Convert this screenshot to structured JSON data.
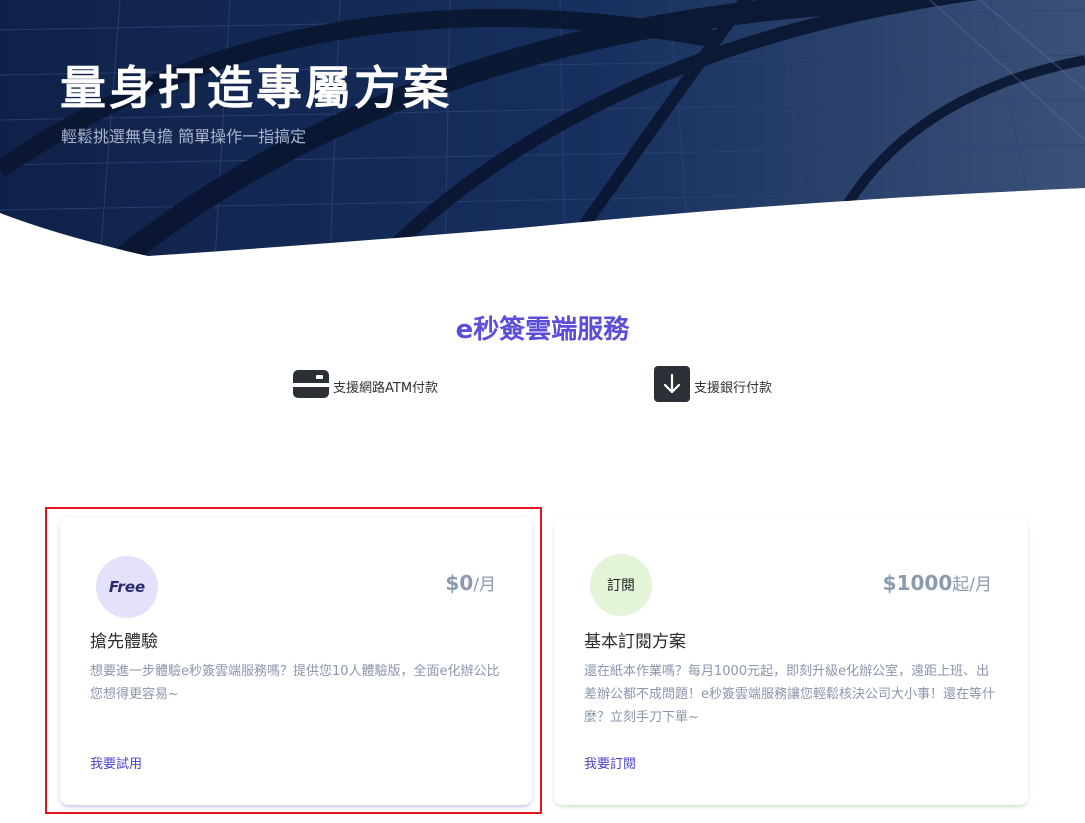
{
  "hero": {
    "title": "量身打造專屬方案",
    "subtitle": "輕鬆挑選無負擔 簡單操作一指搞定"
  },
  "service": {
    "title": "e秒簽雲端服務",
    "payments": [
      {
        "icon": "credit-card-icon",
        "label": "支援網路ATM付款"
      },
      {
        "icon": "download-arrow-icon",
        "label": "支援銀行付款"
      }
    ]
  },
  "plans": [
    {
      "badge": "Free",
      "price": "$0",
      "price_unit": "/月",
      "name": "搶先體驗",
      "description": "想要進一步體驗e秒簽雲端服務嗎？提供您10人體驗版，全面e化辦公比您想得更容易~",
      "link": "我要試用",
      "badge_color": "#e4e1fb"
    },
    {
      "badge": "訂閱",
      "price": "$1000",
      "price_unit": "起/月",
      "name": "基本訂閱方案",
      "description": "還在紙本作業嗎？每月1000元起，即刻升級e化辦公室，遠距上班、出差辦公都不成問題！e秒簽雲端服務讓您輕鬆核決公司大小事！還在等什麼？立刻手刀下單~",
      "link": "我要訂閱",
      "badge_color": "#e3f4d9"
    }
  ],
  "colors": {
    "hero_bg": "#13234a",
    "accent": "#5b4fd9",
    "highlight_border": "#e0161e"
  }
}
